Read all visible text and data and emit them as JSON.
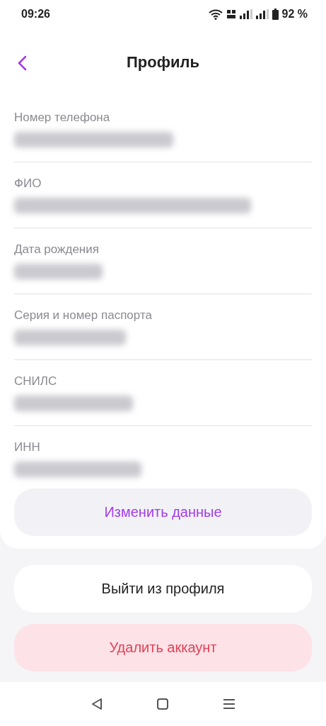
{
  "status_bar": {
    "time": "09:26",
    "battery": "92 %"
  },
  "header": {
    "title": "Профиль"
  },
  "fields": [
    {
      "label": "Номер телефона"
    },
    {
      "label": "ФИО"
    },
    {
      "label": "Дата рождения"
    },
    {
      "label": "Серия и номер паспорта"
    },
    {
      "label": "СНИЛС"
    },
    {
      "label": "ИНН"
    }
  ],
  "edit_button": "Изменить данные",
  "buttons": [
    {
      "label": "Выйти из профиля",
      "kind": "neutral"
    },
    {
      "label": "Удалить аккаунт",
      "kind": "danger"
    }
  ]
}
